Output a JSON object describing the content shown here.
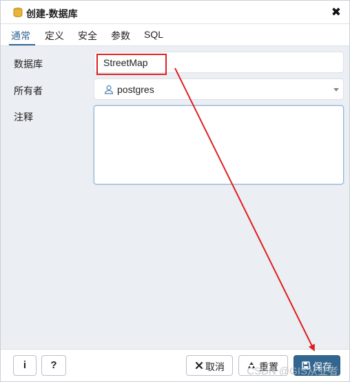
{
  "dialog": {
    "title": "创建-数据库",
    "close_symbol": "✖"
  },
  "tabs": [
    {
      "label": "通常",
      "active": true
    },
    {
      "label": "定义",
      "active": false
    },
    {
      "label": "安全",
      "active": false
    },
    {
      "label": "参数",
      "active": false
    },
    {
      "label": "SQL",
      "active": false
    }
  ],
  "form": {
    "database_label": "数据库",
    "database_value": "StreetMap",
    "owner_label": "所有者",
    "owner_value": "postgres",
    "comment_label": "注释",
    "comment_value": ""
  },
  "footer": {
    "info_glyph": "i",
    "help_glyph": "?",
    "cancel_label": "取消",
    "reset_label": "重置",
    "save_label": "保存"
  },
  "watermark": "CSDN @GIS从业者",
  "colors": {
    "accent": "#326690",
    "annotation_red": "#e01e1e",
    "form_bg": "#ebeef3"
  },
  "icons": {
    "title": "database-icon",
    "owner": "user-icon",
    "cancel": "close-icon",
    "reset": "recycle-icon",
    "save": "floppy-disk-icon"
  }
}
